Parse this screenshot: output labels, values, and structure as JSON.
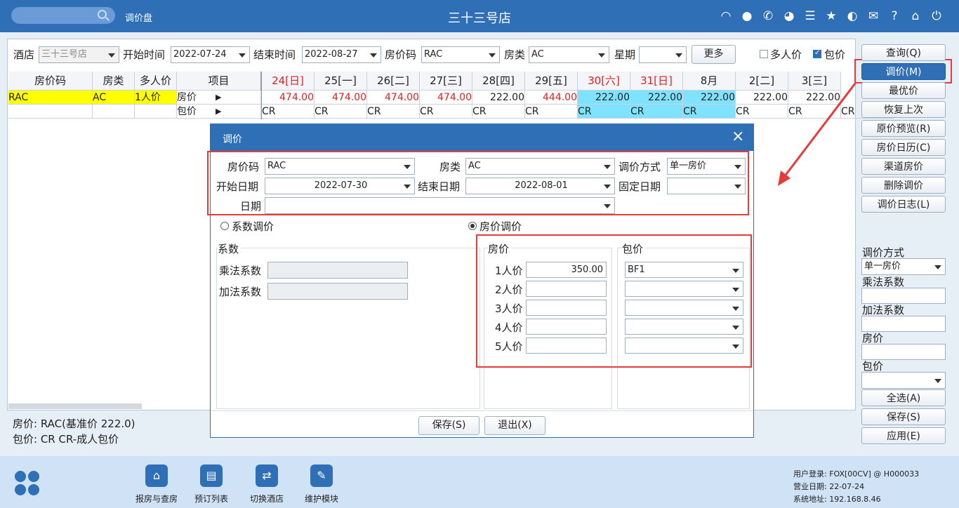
{
  "titlebar": {
    "app_label": "调价盘",
    "title": "三十三号店"
  },
  "filters": {
    "hotel_label": "酒店",
    "hotel_value": "三十三号店",
    "start_label": "开始时间",
    "start_value": "2022-07-24",
    "end_label": "结束时间",
    "end_value": "2022-08-27",
    "ratecode_label": "房价码",
    "ratecode_value": "RAC",
    "roomtype_label": "房类",
    "roomtype_value": "AC",
    "week_label": "星期",
    "week_value": "",
    "more_label": "更多",
    "multi_label": "多人价",
    "package_label": "包价"
  },
  "grid": {
    "headers": [
      "房价码",
      "房类",
      "多人价",
      "项目"
    ],
    "dates": [
      {
        "label": "24[日]",
        "weekend": true
      },
      {
        "label": "25[一]",
        "weekend": false
      },
      {
        "label": "26[二]",
        "weekend": false
      },
      {
        "label": "27[三]",
        "weekend": false
      },
      {
        "label": "28[四]",
        "weekend": false
      },
      {
        "label": "29[五]",
        "weekend": false
      },
      {
        "label": "30[六]",
        "weekend": true
      },
      {
        "label": "31[日]",
        "weekend": true
      },
      {
        "label": "8月",
        "weekend": false
      },
      {
        "label": "2[二]",
        "weekend": false
      },
      {
        "label": "3[三]",
        "weekend": false
      }
    ],
    "row": {
      "ratecode": "RAC",
      "roomtype": "AC",
      "multi": "1人价",
      "item_price": "房价",
      "item_package": "包价",
      "arrow": "▶"
    },
    "prices": [
      {
        "v": "474.00",
        "red": true,
        "hl": false
      },
      {
        "v": "474.00",
        "red": true,
        "hl": false
      },
      {
        "v": "474.00",
        "red": true,
        "hl": false
      },
      {
        "v": "474.00",
        "red": true,
        "hl": false
      },
      {
        "v": "222.00",
        "red": false,
        "hl": false
      },
      {
        "v": "444.00",
        "red": true,
        "hl": false
      },
      {
        "v": "222.00",
        "red": false,
        "hl": true
      },
      {
        "v": "222.00",
        "red": false,
        "hl": true
      },
      {
        "v": "222.00",
        "red": false,
        "hl": true
      },
      {
        "v": "222.00",
        "red": false,
        "hl": false
      },
      {
        "v": "222.00",
        "red": false,
        "hl": false
      }
    ],
    "package_code": "CR",
    "extra_cr": "CR"
  },
  "info": {
    "line1": "房价:  RAC(基准价 222.0)",
    "line2": "包价:  CR  CR-成人包价"
  },
  "right_buttons": [
    "查询(Q)",
    "调价(M)",
    "最优价",
    "恢复上次",
    "原价预览(R)",
    "房价日历(C)",
    "渠道房价",
    "删除调价",
    "调价日志(L)"
  ],
  "right_panel": {
    "method_label": "调价方式",
    "method_value": "单一房价",
    "mult_label": "乘法系数",
    "add_label": "加法系数",
    "price_label": "房价",
    "package_label": "包价",
    "select_all": "全选(A)",
    "save": "保存(S)",
    "apply": "应用(E)"
  },
  "dialog": {
    "title": "调价",
    "close": "×",
    "ratecode_label": "房价码",
    "ratecode_value": "RAC",
    "roomtype_label": "房类",
    "roomtype_value": "AC",
    "method_label": "调价方式",
    "method_value": "单一房价",
    "start_label": "开始日期",
    "start_value": "2022-07-30",
    "end_label": "结束日期",
    "end_value": "2022-08-01",
    "fixed_label": "固定日期",
    "fixed_value": "",
    "date_label": "日期",
    "date_value": "",
    "radio_coef": "系数调价",
    "radio_price": "房价调价",
    "coef_group": "系数",
    "mult_label": "乘法系数",
    "add_label": "加法系数",
    "price_group": "房价",
    "package_group": "包价",
    "persons": [
      {
        "label": "1人价",
        "price": "350.00",
        "pkg": "BF1"
      },
      {
        "label": "2人价",
        "price": "",
        "pkg": ""
      },
      {
        "label": "3人价",
        "price": "",
        "pkg": ""
      },
      {
        "label": "4人价",
        "price": "",
        "pkg": ""
      },
      {
        "label": "5人价",
        "price": "",
        "pkg": ""
      }
    ],
    "save": "保存(S)",
    "exit": "退出(X)"
  },
  "bottom": {
    "nav": [
      "报房与查房",
      "预订列表",
      "切换酒店",
      "维护模块"
    ],
    "user": "用户登录: FOX[00CV] @ H000033",
    "bizdate": "营业日期: 22-07-24",
    "address": "系统地址: 192.168.8.46"
  },
  "colors": {
    "brand": "#2f6fb6",
    "highlight_yellow": "#ffff00",
    "highlight_cyan": "#7fe3ff",
    "weekend_red": "#e02020",
    "annotation_red": "#e53b3b"
  }
}
